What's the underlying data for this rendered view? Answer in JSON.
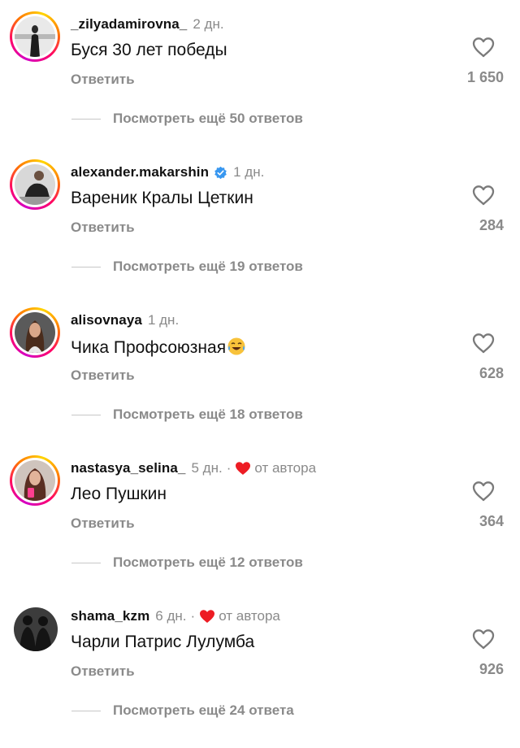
{
  "colors": {
    "author_heart": "#ed1c24",
    "verified": "#3897f0",
    "muted_text": "#8a8a8a",
    "story_ring_start": "#d300c5",
    "story_ring_end": "#ffd600"
  },
  "comments": [
    {
      "username": "_zilyadamirovna_",
      "time": "2 дн.",
      "text": "Буся 30 лет победы",
      "reply_label": "Ответить",
      "likes": "1 650",
      "more_replies": "Посмотреть ещё 50 ответов",
      "verified": false,
      "author_liked": false,
      "has_story_ring": true
    },
    {
      "username": "alexander.makarshin",
      "time": "1 дн.",
      "text": "Вареник Кралы Цеткин",
      "reply_label": "Ответить",
      "likes": "284",
      "more_replies": "Посмотреть ещё 19 ответов",
      "verified": true,
      "author_liked": false,
      "has_story_ring": true
    },
    {
      "username": "alisovnaya",
      "time": "1 дн.",
      "text": "Чика Профсоюзная",
      "emoji": "😂",
      "reply_label": "Ответить",
      "likes": "628",
      "more_replies": "Посмотреть ещё 18 ответов",
      "verified": false,
      "author_liked": false,
      "has_story_ring": true
    },
    {
      "username": "nastasya_selina_",
      "time": "5 дн.",
      "separator": "·",
      "author_label": "от автора",
      "text": "Лео Пушкин",
      "reply_label": "Ответить",
      "likes": "364",
      "more_replies": "Посмотреть ещё 12 ответов",
      "verified": false,
      "author_liked": true,
      "has_story_ring": true
    },
    {
      "username": "shama_kzm",
      "time": "6 дн.",
      "separator": "·",
      "author_label": "от автора",
      "text": "Чарли Патрис Лулумба",
      "reply_label": "Ответить",
      "likes": "926",
      "more_replies": "Посмотреть ещё 24 ответа",
      "verified": false,
      "author_liked": true,
      "has_story_ring": false
    }
  ],
  "icons": {
    "like": "heart-outline-icon",
    "author_like": "heart-filled-icon",
    "verified": "verified-badge-icon",
    "emoji": "face-with-tears-of-joy-icon"
  }
}
